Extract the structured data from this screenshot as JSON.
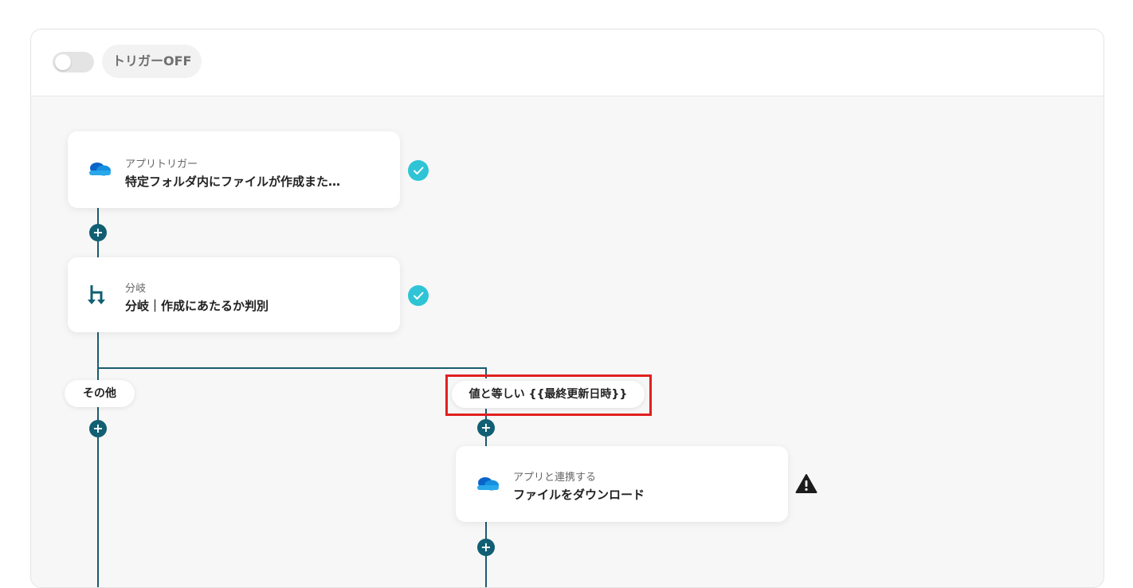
{
  "header": {
    "trigger_status": "トリガーOFF"
  },
  "flow": {
    "trigger_card": {
      "subtitle": "アプリトリガー",
      "title": "特定フォルダ内にファイルが作成また…",
      "icon": "onedrive-icon"
    },
    "branch_card": {
      "subtitle": "分岐",
      "title": "分岐｜作成にあたるか判別",
      "icon": "branch-icon"
    },
    "branches": {
      "other_label": "その他",
      "condition_label": "値と等しい {{最終更新日時}}"
    },
    "action_card": {
      "subtitle": "アプリと連携する",
      "title": "ファイルをダウンロード",
      "icon": "onedrive-icon"
    }
  },
  "colors": {
    "line": "#1b5b70",
    "plus_button": "#115f73",
    "check_badge": "#2ec4d6",
    "highlight_border": "#e02020"
  }
}
